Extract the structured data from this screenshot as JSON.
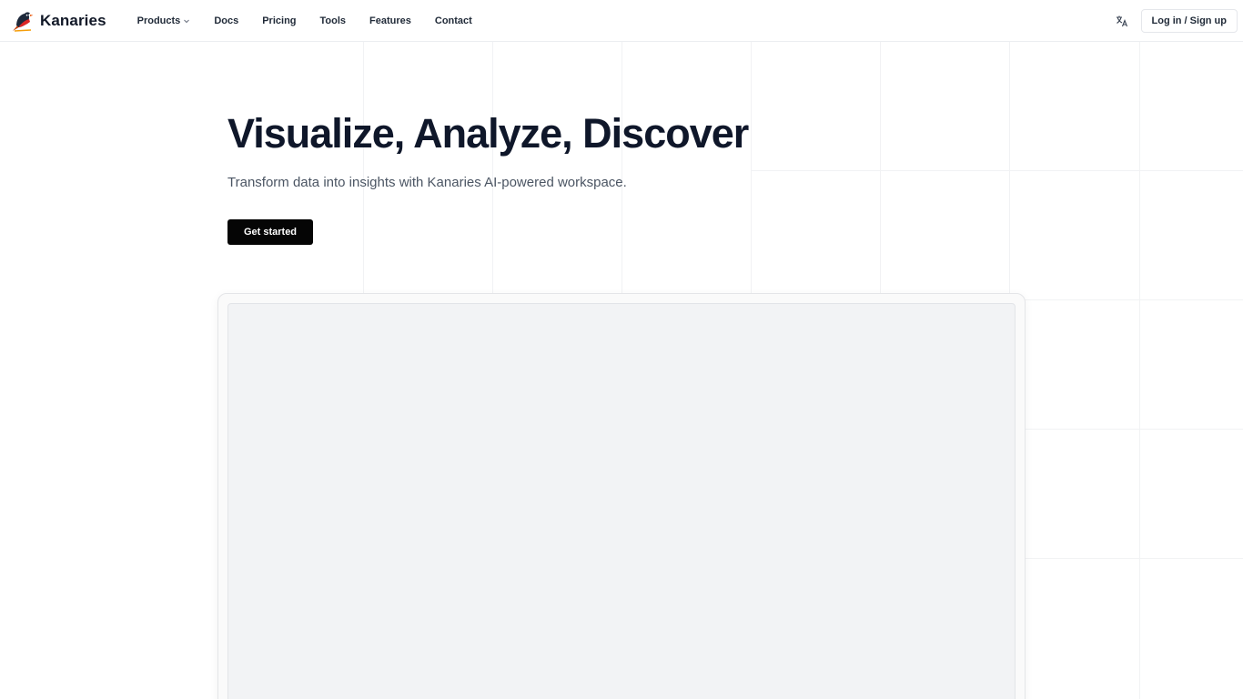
{
  "brand": {
    "name": "Kanaries",
    "logo_icon": "bird-logo-icon"
  },
  "nav": {
    "items": [
      {
        "label": "Products",
        "has_dropdown": true
      },
      {
        "label": "Docs"
      },
      {
        "label": "Pricing"
      },
      {
        "label": "Tools"
      },
      {
        "label": "Features"
      },
      {
        "label": "Contact"
      }
    ]
  },
  "header_actions": {
    "language_icon": "translate-icon",
    "login_label": "Log in / Sign up"
  },
  "hero": {
    "title": "Visualize, Analyze, Discover",
    "subtitle": "Transform data into insights with Kanaries AI-powered workspace.",
    "cta_label": "Get started"
  },
  "colors": {
    "text_primary": "#0f172a",
    "cta_background": "#050505",
    "grid_line": "#f1f2f4",
    "preview_background": "#f2f3f5"
  }
}
